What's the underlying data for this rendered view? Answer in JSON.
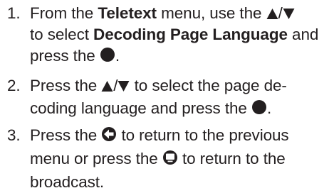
{
  "steps": [
    {
      "number": "1.",
      "line1": {
        "pre": "From the ",
        "bold": "Teletext",
        "post": " menu, use the "
      },
      "line2": {
        "pre": "to select ",
        "bold": "Decoding Page Language",
        "post": " and"
      },
      "line3": {
        "pre": "press the "
      },
      "icons": [
        "up-arrow-icon",
        "down-arrow-icon",
        "ok-button-icon"
      ]
    },
    {
      "number": "2.",
      "line1": {
        "pre": "Press the ",
        "post": " to select the page de-"
      },
      "line2": {
        "pre": "coding language and press the "
      },
      "icons": [
        "up-arrow-icon",
        "down-arrow-icon",
        "ok-button-icon"
      ]
    },
    {
      "number": "3.",
      "line1": {
        "pre": "Press the ",
        "post": " to return to the previous"
      },
      "line2": {
        "pre": "menu or press the ",
        "post": " to return to the"
      },
      "line3": {
        "pre": "broadcast."
      },
      "icons": [
        "back-arrow-icon",
        "tv-broadcast-icon"
      ]
    }
  ],
  "glyphs": {
    "slash": "/",
    "period": "."
  },
  "colors": {
    "text": "#231f20",
    "icon": "#231f20"
  }
}
